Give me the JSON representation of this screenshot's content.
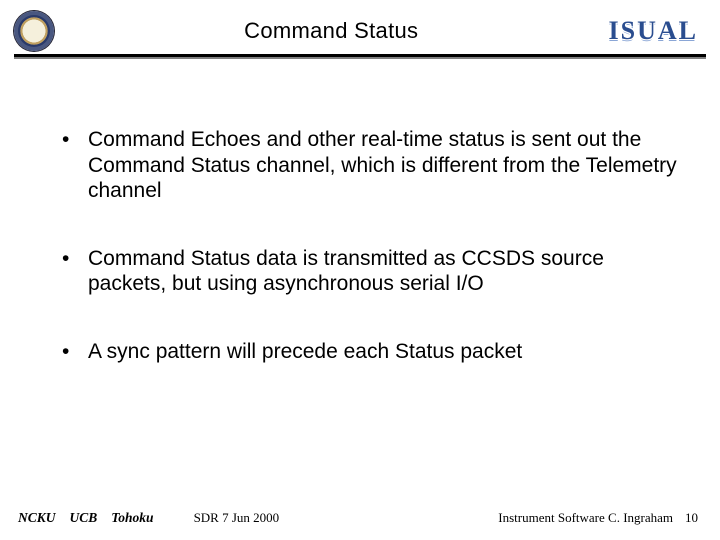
{
  "header": {
    "title": "Command Status",
    "brand": "ISUAL"
  },
  "bullets": [
    "Command Echoes and other real-time status is sent out the Command Status channel, which is different from the Telemetry channel",
    "Command Status data is transmitted as CCSDS source packets, but using asynchronous serial I/O",
    "A sync pattern will precede each Status packet"
  ],
  "footer": {
    "inst1": "NCKU",
    "inst2": "UCB",
    "inst3": "Tohoku",
    "event": "SDR 7 Jun 2000",
    "right": "Instrument Software   C. Ingraham",
    "page": "10"
  }
}
